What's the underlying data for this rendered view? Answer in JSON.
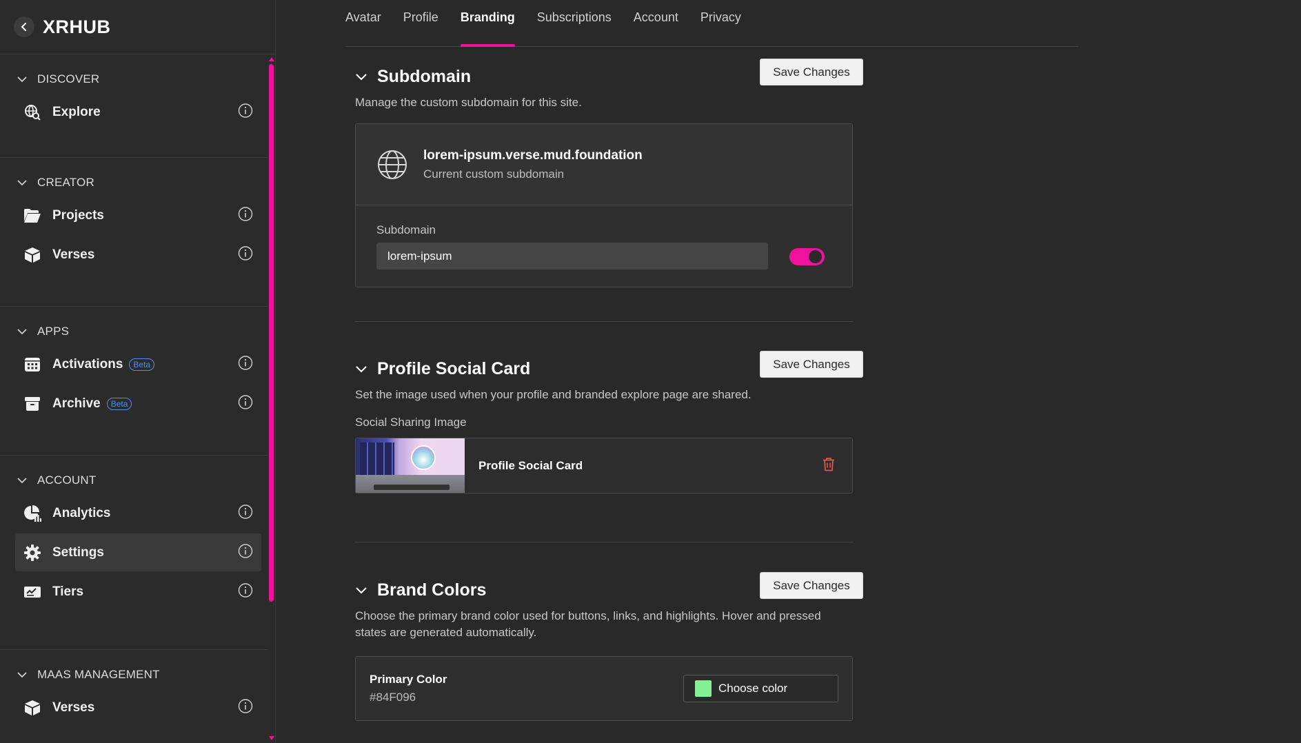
{
  "app": {
    "name": "XRHUB"
  },
  "sidebar": {
    "sections": [
      {
        "title": "DISCOVER",
        "items": [
          {
            "label": "Explore",
            "icon": "globe-search-icon"
          }
        ]
      },
      {
        "title": "CREATOR",
        "items": [
          {
            "label": "Projects",
            "icon": "folder-open-icon"
          },
          {
            "label": "Verses",
            "icon": "cube-icon"
          }
        ]
      },
      {
        "title": "APPS",
        "items": [
          {
            "label": "Activations",
            "icon": "calendar-grid-icon",
            "badge": "Beta"
          },
          {
            "label": "Archive",
            "icon": "archive-box-icon",
            "badge": "Beta"
          }
        ]
      },
      {
        "title": "ACCOUNT",
        "items": [
          {
            "label": "Analytics",
            "icon": "pie-chart-icon"
          },
          {
            "label": "Settings",
            "icon": "gear-icon",
            "active": true
          },
          {
            "label": "Tiers",
            "icon": "ticket-card-icon"
          }
        ]
      },
      {
        "title": "MAAS MANAGEMENT",
        "items": [
          {
            "label": "Verses",
            "icon": "cube-icon"
          }
        ]
      }
    ]
  },
  "tabs": [
    {
      "label": "Avatar"
    },
    {
      "label": "Profile"
    },
    {
      "label": "Branding",
      "active": true
    },
    {
      "label": "Subscriptions"
    },
    {
      "label": "Account"
    },
    {
      "label": "Privacy"
    }
  ],
  "subdomain": {
    "title": "Subdomain",
    "save_label": "Save Changes",
    "description": "Manage the custom subdomain for this site.",
    "current_domain": "lorem-ipsum.verse.mud.foundation",
    "current_label": "Current custom subdomain",
    "field_label": "Subdomain",
    "field_value": "lorem-ipsum",
    "toggle_on": true
  },
  "social_card": {
    "title": "Profile Social Card",
    "save_label": "Save Changes",
    "description": "Set the image used when your profile and branded explore page are shared.",
    "image_label": "Social Sharing Image",
    "image_name": "Profile Social Card"
  },
  "brand_colors": {
    "title": "Brand Colors",
    "save_label": "Save Changes",
    "description": "Choose the primary brand color used for buttons, links, and highlights. Hover and pressed states are generated automatically.",
    "primary_label": "Primary Color",
    "primary_hex": "#84F096",
    "choose_label": "Choose color"
  },
  "colors": {
    "accent": "#f0129c",
    "primary_swatch": "#84F096",
    "delete": "#e5534b",
    "beta": "#4f8ff2"
  }
}
